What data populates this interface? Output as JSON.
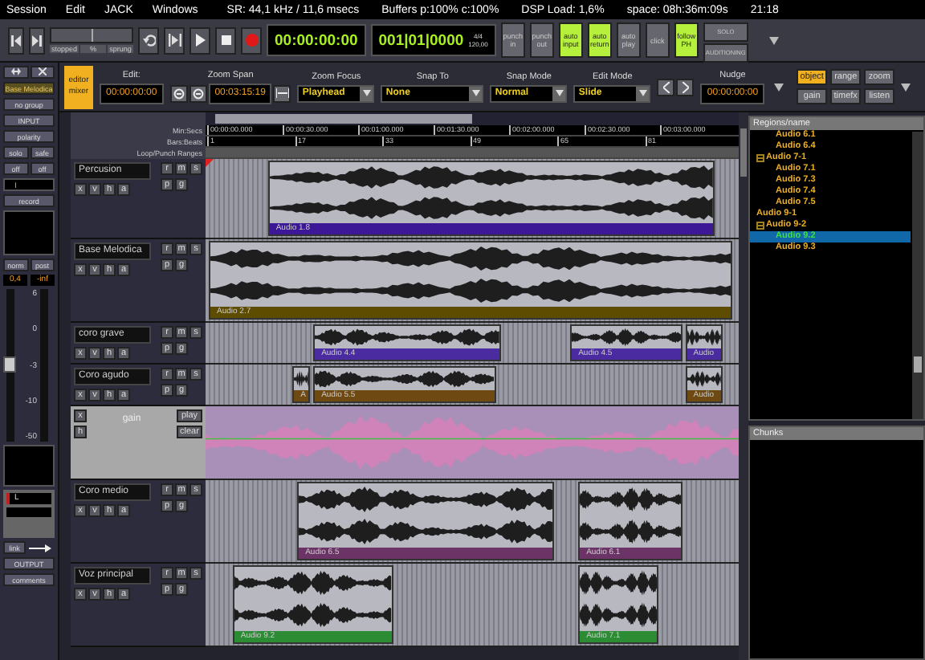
{
  "menu_bar": {
    "menus": [
      "Session",
      "Edit",
      "JACK",
      "Windows"
    ],
    "status": [
      "SR: 44,1 kHz / 11,6 msecs",
      "Buffers p:100% c:100%",
      "DSP Load: 1,6%",
      "space: 08h:36m:09s",
      "21:18"
    ]
  },
  "transport": {
    "shuttle": {
      "state": "stopped",
      "unit": "%",
      "mode": "sprung",
      "level": 0.5
    },
    "clock": "00:00:00:00",
    "bbt_clock": "001|01|0000",
    "meter": "4/4",
    "tempo": "120,00",
    "toggles": [
      {
        "label": "punch in",
        "on": false
      },
      {
        "label": "punch out",
        "on": false
      },
      {
        "label": "auto input",
        "on": true
      },
      {
        "label": "auto return",
        "on": true
      },
      {
        "label": "auto play",
        "on": false
      },
      {
        "label": "click",
        "on": false
      },
      {
        "label": "follow PH",
        "on": true
      }
    ],
    "solo": {
      "label": "SOLO",
      "sublabel": "AUDITIONING"
    }
  },
  "mixer_strip": {
    "name": "Base Melodica",
    "group": "no group",
    "input": "INPUT",
    "polarity": "polarity",
    "pair_1": [
      "solo",
      "safe"
    ],
    "pair_2": [
      "off",
      "off"
    ],
    "input_field": "I",
    "record": "record",
    "pair_3": [
      "norm",
      "post"
    ],
    "gain": "0,4",
    "peak": "-inf",
    "scale": [
      "6",
      "0",
      "-3",
      "-10",
      "-50"
    ],
    "port": "L",
    "link": "link",
    "output": "OUTPUT",
    "comments": "comments"
  },
  "toolbar": {
    "editor_mixer": "editor mixer",
    "edit_clock": {
      "label": "Edit:",
      "value": "00:00:00:00"
    },
    "zoom_span": {
      "label": "Zoom Span",
      "value": "00:03:15:19"
    },
    "dropdowns": [
      {
        "label": "Zoom Focus",
        "value": "Playhead"
      },
      {
        "label": "Snap To",
        "value": "None"
      },
      {
        "label": "Snap Mode",
        "value": "Normal"
      },
      {
        "label": "Edit Mode",
        "value": "Slide"
      }
    ],
    "nudge": {
      "label": "Nudge",
      "value": "00:00:00:00"
    },
    "modes": [
      {
        "label": "object",
        "selected": true
      },
      {
        "label": "range",
        "selected": false
      },
      {
        "label": "zoom",
        "selected": false
      },
      {
        "label": "gain",
        "selected": false
      },
      {
        "label": "timefx",
        "selected": false
      },
      {
        "label": "listen",
        "selected": false
      }
    ]
  },
  "rulers": [
    {
      "name": "Min:Secs",
      "ticks": [
        "00:00:00.000",
        "00:00:30.000",
        "00:01:00.000",
        "00:01:30.000",
        "00:02:00.000",
        "00:02:30.000",
        "00:03:00.000"
      ]
    },
    {
      "name": "Bars:Beats",
      "ticks": [
        "1",
        "17",
        "33",
        "49",
        "65",
        "81"
      ]
    },
    {
      "name": "Loop/Punch Ranges"
    }
  ],
  "tracks": [
    {
      "kind": "audio",
      "name": "Percusion",
      "color": "#3c1896",
      "buttons": [
        "r",
        "m",
        "s",
        "x",
        "v",
        "h",
        "a",
        "p",
        "g"
      ],
      "regions": [
        {
          "label": "Audio 1.8"
        }
      ]
    },
    {
      "kind": "audio",
      "name": "Base Melodica",
      "color": "#5e4c00",
      "buttons": [
        "r",
        "m",
        "s",
        "x",
        "v",
        "h",
        "a",
        "p",
        "g"
      ],
      "regions": [
        {
          "label": "Audio 2.7"
        }
      ]
    },
    {
      "kind": "audio",
      "name": "coro grave",
      "color": "#4a2ca0",
      "buttons": [
        "r",
        "m",
        "s",
        "x",
        "v",
        "h",
        "a",
        "p",
        "g"
      ],
      "regions": [
        {
          "label": "Audio 4.4"
        },
        {
          "label": "Audio 4.5"
        },
        {
          "label": "Audio"
        }
      ]
    },
    {
      "kind": "audio",
      "name": "Coro agudo",
      "color": "#6e4a12",
      "buttons": [
        "r",
        "m",
        "s",
        "x",
        "v",
        "h",
        "a",
        "p",
        "g"
      ],
      "regions": [
        {
          "label": "A"
        },
        {
          "label": "Audio 5.5"
        },
        {
          "label": "Audio"
        }
      ]
    },
    {
      "kind": "automation",
      "name": "gain",
      "buttons": [
        "x",
        "h",
        "play",
        "clear"
      ]
    },
    {
      "kind": "audio",
      "name": "Coro medio",
      "color": "#6c3466",
      "buttons": [
        "r",
        "m",
        "s",
        "x",
        "v",
        "h",
        "a",
        "p",
        "g"
      ],
      "regions": [
        {
          "label": "Audio 6.5"
        },
        {
          "label": "Audio 6.1"
        }
      ]
    },
    {
      "kind": "audio",
      "name": "Voz principal",
      "color": "#2c8c34",
      "buttons": [
        "r",
        "m",
        "s",
        "x",
        "v",
        "h",
        "a",
        "p",
        "g"
      ],
      "regions": [
        {
          "label": "Audio 9.2"
        },
        {
          "label": "Audio 7.1"
        }
      ]
    }
  ],
  "regions_list": {
    "header": "Regions/name",
    "items": [
      {
        "children": [
          {
            "label": "Audio 6.1",
            "selected": false
          },
          {
            "label": "Audio 6.4",
            "selected": false
          }
        ]
      },
      {
        "label": "Audio 7-1",
        "expanded": true,
        "selected": false,
        "children": [
          {
            "label": "Audio 7.1",
            "selected": false
          },
          {
            "label": "Audio 7.3",
            "selected": false
          },
          {
            "label": "Audio 7.4",
            "selected": false
          },
          {
            "label": "Audio 7.5",
            "selected": false
          }
        ]
      },
      {
        "label": "Audio 9-1",
        "selected": false
      },
      {
        "label": "Audio 9-2",
        "expanded": true,
        "selected": false,
        "children": [
          {
            "label": "Audio 9.2",
            "selected": true
          },
          {
            "label": "Audio 9.3",
            "selected": false
          }
        ]
      }
    ],
    "chunks_header": "Chunks"
  }
}
